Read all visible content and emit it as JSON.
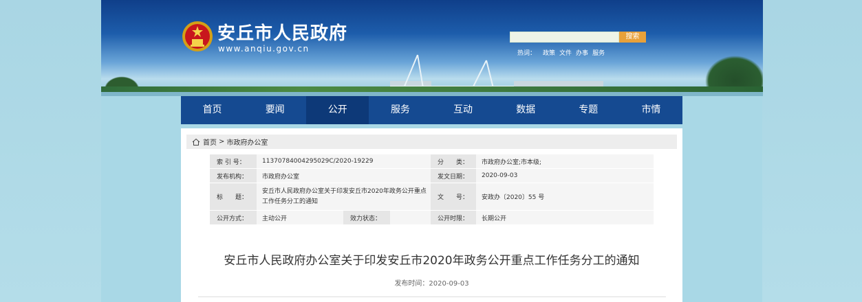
{
  "header": {
    "site_title": "安丘市人民政府",
    "site_url": "www.anqiu.gov.cn",
    "search": {
      "placeholder": "",
      "button_label": "搜索"
    },
    "hotwords": {
      "label": "热词：",
      "items": [
        "政策",
        "文件",
        "办事",
        "服务"
      ]
    }
  },
  "nav": {
    "items": [
      "首页",
      "要闻",
      "公开",
      "服务",
      "互动",
      "数据",
      "专题",
      "市情"
    ],
    "active_index": 2
  },
  "breadcrumb": {
    "home": "首页",
    "separator": ">",
    "current": "市政府办公室"
  },
  "meta": {
    "index_label": "索 引 号：",
    "index_value": "11370784004295029C/2020-19229",
    "category_label": "分　　类：",
    "category_value": "市政府办公室;市本级;",
    "publisher_label": "发布机构：",
    "publisher_value": "市政府办公室",
    "issue_date_label": "发文日期：",
    "issue_date_value": "2020-09-03",
    "title_label": "标　　题：",
    "title_value": "安丘市人民政府办公室关于印发安丘市2020年政务公开重点工作任务分工的通知",
    "doc_no_label": "文　　号：",
    "doc_no_value": "安政办〔2020〕55 号",
    "mode_label": "公开方式：",
    "mode_value": "主动公开",
    "validity_label": "效力状态：",
    "validity_value": "",
    "time_label": "公开时限：",
    "time_value": "长期公开"
  },
  "article": {
    "title": "安丘市人民政府办公室关于印发安丘市2020年政务公开重点工作任务分工的通知",
    "publish_time": "发布时间：2020-09-03"
  },
  "colors": {
    "nav_bg": "#154a91",
    "nav_active": "#0d3978",
    "search_button": "#e8a13a"
  }
}
